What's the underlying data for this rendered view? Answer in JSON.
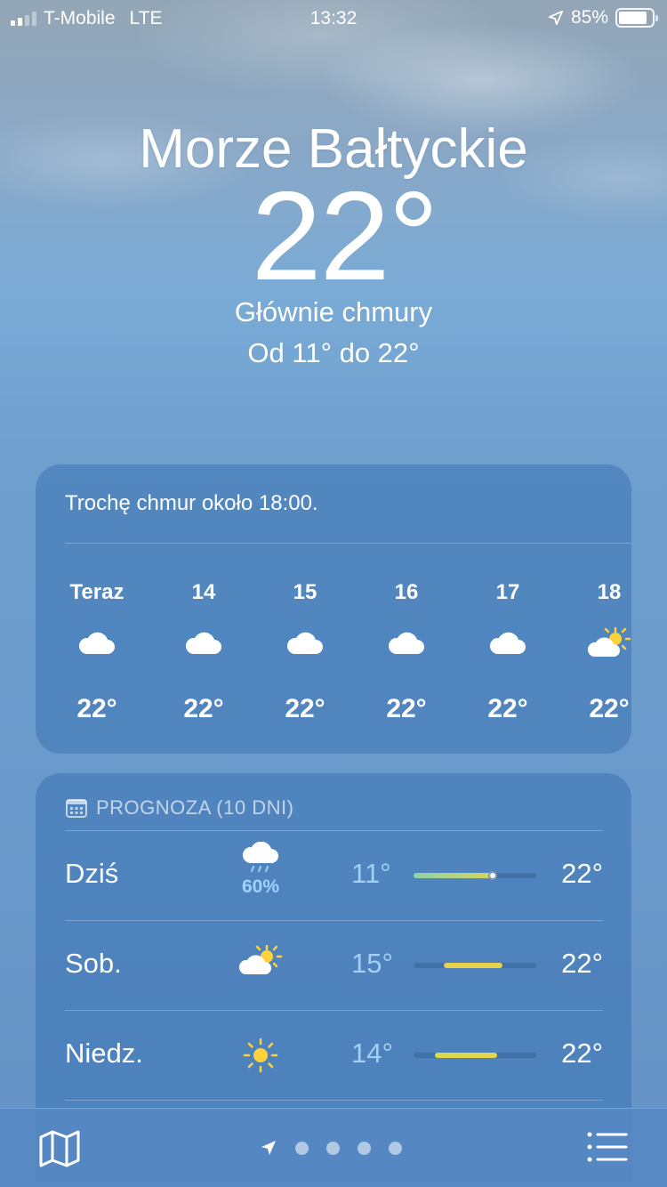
{
  "status_bar": {
    "carrier": "T-Mobile",
    "network": "LTE",
    "time": "13:32",
    "battery": "85%",
    "signal_bars": 2,
    "location_icon": "location-arrow-icon"
  },
  "location": {
    "city": "Morze Bałtyckie",
    "temperature": "22°",
    "condition": "Głównie chmury",
    "range": "Od 11°  do 22°"
  },
  "hourly": {
    "summary": "Trochę chmur około 18:00.",
    "items": [
      {
        "label": "Teraz",
        "icon": "cloud-icon",
        "temp": "22°"
      },
      {
        "label": "14",
        "icon": "cloud-icon",
        "temp": "22°"
      },
      {
        "label": "15",
        "icon": "cloud-icon",
        "temp": "22°"
      },
      {
        "label": "16",
        "icon": "cloud-icon",
        "temp": "22°"
      },
      {
        "label": "17",
        "icon": "cloud-icon",
        "temp": "22°"
      },
      {
        "label": "18",
        "icon": "partly-sunny-icon",
        "temp": "22°"
      }
    ]
  },
  "daily": {
    "title": "PROGNOZA (10 DNI)",
    "calendar_icon": "calendar-icon",
    "rows": [
      {
        "day": "Dziś",
        "icon": "rain-cloud-icon",
        "precip": "60%",
        "low": "11°",
        "high": "22°",
        "bar_colors": [
          "#8fd3a8",
          "#d7d65a"
        ],
        "current_marker": true
      },
      {
        "day": "Sob.",
        "icon": "partly-sunny-icon",
        "precip": "",
        "low": "15°",
        "high": "22°",
        "bar_colors": [
          "#e8d24a",
          "#e8d24a"
        ],
        "current_marker": false
      },
      {
        "day": "Niedz.",
        "icon": "sun-icon",
        "precip": "",
        "low": "14°",
        "high": "22°",
        "bar_colors": [
          "#d9d84c",
          "#e4d44b"
        ],
        "current_marker": false
      }
    ]
  },
  "colors": {
    "sun": "#ffd23a",
    "precip": "#9fd3ff",
    "card": "#3a73b4",
    "tabbar": "#5689c3"
  },
  "tabbar": {
    "map_icon": "map-icon",
    "location_page_icon": "location-arrow-icon",
    "page_count": 5,
    "list_icon": "list-icon"
  }
}
